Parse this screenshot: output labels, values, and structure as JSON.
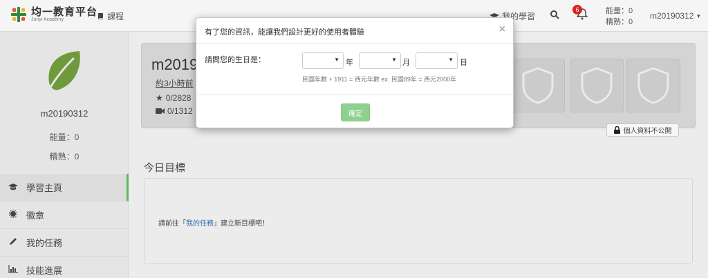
{
  "navbar": {
    "brand_name": "均一教育平台",
    "brand_sub": "Junyi Academy",
    "courses_label": "課程",
    "mylearning_label": "我的學習",
    "notification_count": "6",
    "energy_label": "能量：0",
    "mastery_label": "精熟：0",
    "username": "m20190312"
  },
  "sidebar": {
    "username": "m20190312",
    "energy": "能量：0",
    "mastery": "精熟：0",
    "items": [
      {
        "label": "學習主頁",
        "icon": "graduation-cap-icon"
      },
      {
        "label": "徽章",
        "icon": "badge-icon"
      },
      {
        "label": "我的任務",
        "icon": "pencil-icon"
      },
      {
        "label": "技能進展",
        "icon": "bar-chart-icon"
      }
    ]
  },
  "profile": {
    "name": "m2019",
    "link_text": "約3小時前",
    "points": "0/2828",
    "videos": "0/1312",
    "private_label": "個人資料不公開"
  },
  "goal": {
    "title": "今日目標",
    "text_before": "請前往「",
    "link": "我的任務",
    "text_after": "」建立新目標吧！"
  },
  "modal": {
    "title": "有了您的資訊，能讓我們設計更好的使用者體驗",
    "close": "×",
    "question": "請問您的生日是：",
    "year_unit": "年",
    "month_unit": "月",
    "day_unit": "日",
    "hint": "民國年數 + 1911 = 西元年數 ex. 民國89年 = 西元2000年",
    "confirm": "確定"
  },
  "colors": {
    "accent_green": "#5cb85c",
    "confirm_button": "#8ed08e",
    "badge_red": "#d9261c",
    "leaf_green": "#6e9a3c"
  }
}
